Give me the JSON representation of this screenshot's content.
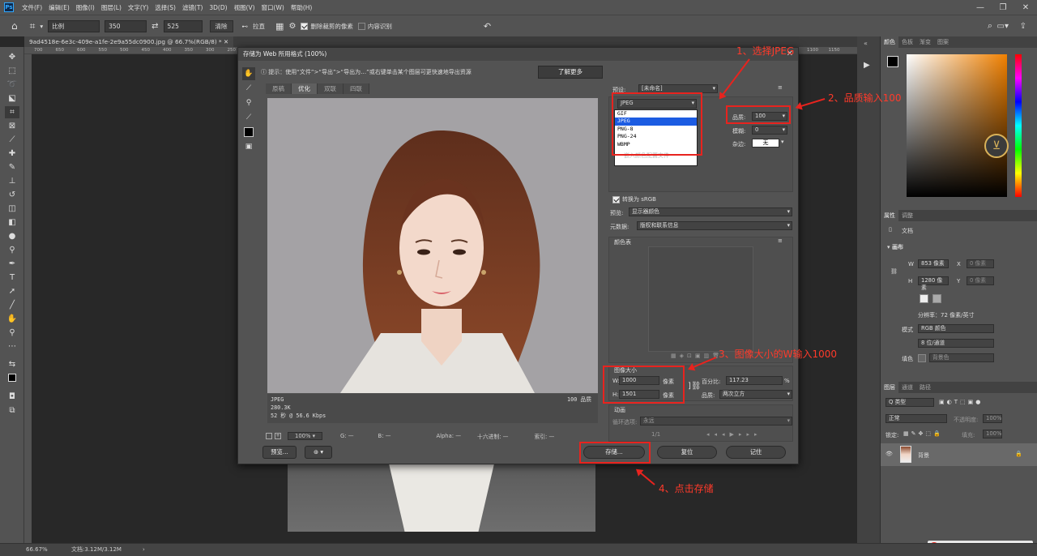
{
  "menu": {
    "logo": "Ps",
    "items": [
      "文件(F)",
      "编辑(E)",
      "图像(I)",
      "图层(L)",
      "文字(Y)",
      "选择(S)",
      "滤镜(T)",
      "3D(D)",
      "视图(V)",
      "窗口(W)",
      "帮助(H)"
    ]
  },
  "options": {
    "ratio": "比例",
    "w": "350",
    "h": "525",
    "clear": "清除",
    "straighten": "拉直",
    "delete_cropped": "删除裁剪的像素",
    "content_aware": "内容识别"
  },
  "document": {
    "tab": "9ad4518e-6e3c-409e-a1fe-2e9a55dc0900.jpg @ 66.7%(RGB/8) *",
    "ruler": [
      "700",
      "650",
      "600",
      "550",
      "500",
      "450",
      "400",
      "350",
      "300",
      "250",
      "200",
      "150",
      "100",
      "50",
      "0",
      "50",
      "100",
      "150",
      "200",
      "250",
      "300",
      "350",
      "400",
      "450",
      "500",
      "550",
      "600",
      "650",
      "700",
      "750",
      "800",
      "850",
      "900",
      "950",
      "1000",
      "1050",
      "1100",
      "1150"
    ]
  },
  "status": {
    "zoom": "66.67%",
    "doc": "文档:3.12M/3.12M"
  },
  "dialog": {
    "title": "存储为 Web 所用格式 (100%)",
    "tip": "提示：使用“文件”>“导出”>“导出为…”或右键单击某个图层可更快速地导出资源",
    "learn_more": "了解更多",
    "tabs": [
      "原稿",
      "优化",
      "双联",
      "四联"
    ],
    "preview_info": {
      "format": "JPEG",
      "size": "280.3K",
      "time": "52 秒 @ 56.6 Kbps",
      "quality_label": "100 品质"
    },
    "zoom": "100%",
    "readout": {
      "g": "G: —",
      "b": "B: —",
      "alpha": "Alpha: —",
      "hex": "十六进制: —",
      "index": "索引: —"
    },
    "preset_label": "预设:",
    "preset_value": "[未命名]",
    "format_value": "JPEG",
    "format_options": [
      "GIF",
      "JPEG",
      "PNG-8",
      "PNG-24",
      "WBMP"
    ],
    "quality_label": "品质:",
    "quality_value": "100",
    "blur_label": "模糊:",
    "blur_value": "0",
    "matte_label": "杂边:",
    "matte_value": "无",
    "embed_profile": "嵌入颜色配置文件",
    "convert_srgb": "转换为 sRGB",
    "preview_label": "预览:",
    "preview_value": "显示器颜色",
    "metadata_label": "元数据:",
    "metadata_value": "版权和联系信息",
    "color_table": "颜色表",
    "image_size": "图像大小",
    "w_label": "W:",
    "w_value": "1000",
    "h_label": "H:",
    "h_value": "1501",
    "unit": "像素",
    "percent_label": "百分比:",
    "percent_value": "117.23",
    "percent_unit": "%",
    "quality2_label": "品质:",
    "quality2_value": "两次立方",
    "animation": "动画",
    "loop_label": "循环选项:",
    "loop_value": "永远",
    "frame": "1/1",
    "buttons": {
      "preview": "预览...",
      "save": "存储...",
      "reset": "复位",
      "remember": "记住"
    }
  },
  "annotations": {
    "a1": "1、选择JPEG",
    "a2": "2、品质输入100",
    "a3": "3、图像大小的W输入1000",
    "a4": "4、点击存储"
  },
  "panels": {
    "color_tabs": [
      "颜色",
      "色板",
      "渐变",
      "图案"
    ],
    "props_tabs": [
      "属性",
      "调整"
    ],
    "doc": "文档",
    "canvas": "画布",
    "w_label": "W",
    "w_value": "853 像素",
    "h_label": "H",
    "h_value": "1280 像素",
    "x_label": "X",
    "x_placeholder": "0 像素",
    "y_label": "Y",
    "y_placeholder": "0 像素",
    "resolution": "分辨率：72 像素/英寸",
    "mode_label": "模式",
    "mode_value": "RGB 颜色",
    "depth_value": "8 位/通道",
    "fill_label": "填色",
    "fill_value": "背景色",
    "layer_tabs": [
      "图层",
      "通道",
      "路径"
    ],
    "kind": "Q 类型",
    "blend": "正常",
    "opacity_label": "不透明度:",
    "opacity_value": "100%",
    "lock_label": "锁定:",
    "fill2_label": "填充:",
    "fill2_value": "100%",
    "layer_name": "背景",
    "ime": "中"
  }
}
